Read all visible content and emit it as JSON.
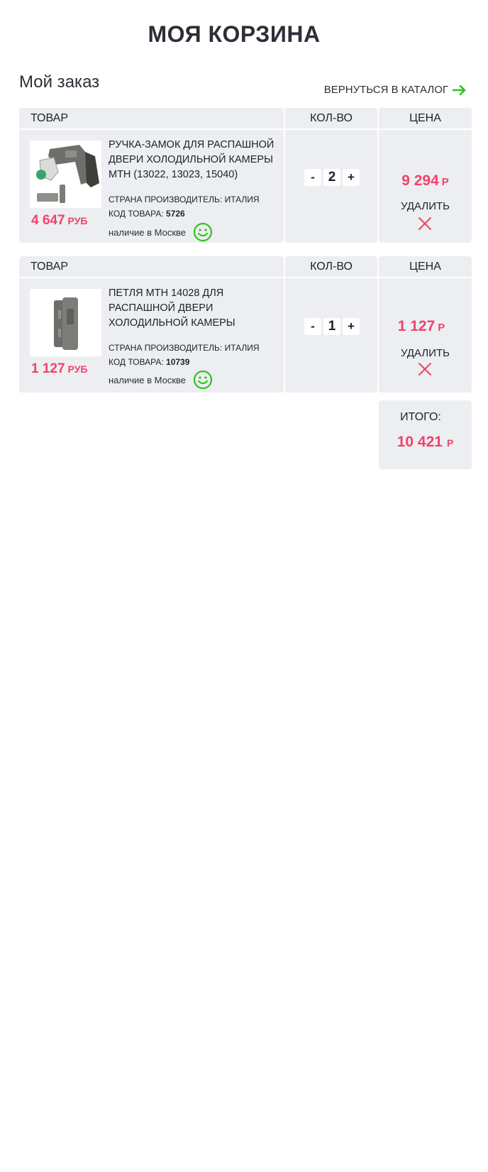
{
  "page": {
    "title": "МОЯ КОРЗИНА",
    "order_title": "Мой заказ",
    "back_link": "ВЕРНУТЬСЯ В КАТАЛОГ"
  },
  "columns": {
    "item": "ТОВАР",
    "qty": "КОЛ-ВО",
    "price": "ЦЕНА"
  },
  "items": [
    {
      "name": "РУЧКА-ЗАМОК ДЛЯ РАСПАШНОЙ ДВЕРИ ХОЛОДИЛЬНОЙ КАМЕРЫ MTH (13022, 13023, 15040)",
      "country_label": "СТРАНА ПРОИЗВОДИТЕЛЬ:",
      "country": "ИТАЛИЯ",
      "code_label": "КОД ТОВАРА:",
      "code": "5726",
      "stock": "наличие в Москве",
      "unit_price": "4 647",
      "unit_currency": "РУБ",
      "qty_minus": "-",
      "qty": "2",
      "qty_plus": "+",
      "line_total": "9 294",
      "line_currency": "Р",
      "delete_label": "УДАЛИТЬ",
      "image_icon": "door-handle-lock-image"
    },
    {
      "name": "ПЕТЛЯ MTH 14028 ДЛЯ РАСПАШНОЙ ДВЕРИ ХОЛОДИЛЬНОЙ КАМЕРЫ",
      "country_label": "СТРАНА ПРОИЗВОДИТЕЛЬ:",
      "country": "ИТАЛИЯ",
      "code_label": "КОД ТОВАРА:",
      "code": "10739",
      "stock": "наличие в Москве",
      "unit_price": "1 127",
      "unit_currency": "РУБ",
      "qty_minus": "-",
      "qty": "1",
      "qty_plus": "+",
      "line_total": "1 127",
      "line_currency": "Р",
      "delete_label": "УДАЛИТЬ",
      "image_icon": "door-hinge-image"
    }
  ],
  "total": {
    "label": "ИТОГО:",
    "value": "10 421",
    "currency": "Р"
  },
  "colors": {
    "accent_price": "#f0436a",
    "panel_bg": "#eceef1",
    "smile_green": "#2fc21f",
    "arrow_green": "#2fc21f",
    "delete_red": "#f0436a"
  }
}
